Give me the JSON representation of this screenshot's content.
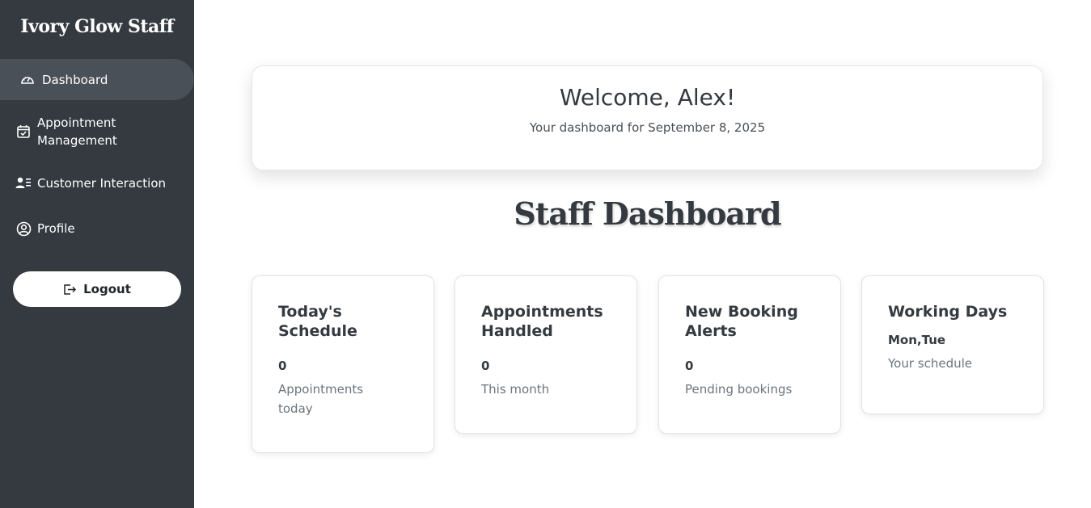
{
  "sidebar": {
    "brand": "Ivory Glow Staff",
    "items": [
      {
        "label": "Dashboard",
        "icon": "gauge-icon"
      },
      {
        "label_line1": "Appointment",
        "label_line2": "Management",
        "icon": "calendar-check-icon"
      },
      {
        "label": "Customer Interaction",
        "icon": "user-list-icon"
      },
      {
        "label": "Profile",
        "icon": "user-circle-icon"
      }
    ],
    "logout_label": "Logout"
  },
  "welcome": {
    "title": "Welcome, Alex!",
    "subtitle": "Your dashboard for September 8, 2025"
  },
  "page_title": "Staff Dashboard",
  "cards": [
    {
      "title_line1": "Today's",
      "title_line2": "Schedule",
      "value": "0",
      "label_line1": "Appointments",
      "label_line2": "today"
    },
    {
      "title_line1": "Appointments",
      "title_line2": "Handled",
      "value": "0",
      "label": "This month"
    },
    {
      "title_line1": "New Booking",
      "title_line2": "Alerts",
      "value": "0",
      "label": "Pending bookings"
    },
    {
      "title": "Working Days",
      "value": "Mon,Tue",
      "label": "Your schedule"
    }
  ],
  "colors": {
    "sidebar_bg": "#343a40",
    "active_item_bg": "#4a5058",
    "text_dark": "#343a40",
    "text_muted": "#6c757d"
  }
}
